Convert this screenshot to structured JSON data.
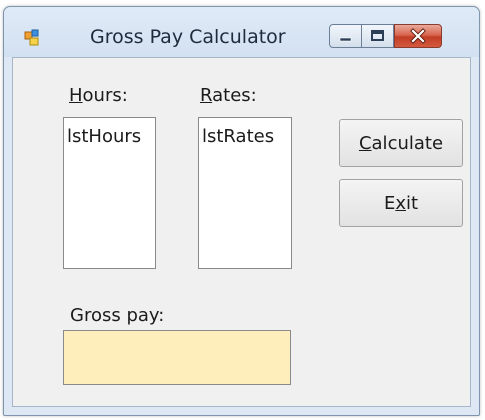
{
  "window": {
    "title": "Gross Pay Calculator",
    "colors": {
      "frame": "#dde8f4",
      "client": "#f0f0f0",
      "output_bg": "#fdeebc",
      "close_button": "#c23d26"
    },
    "caption_buttons": [
      {
        "name": "minimize",
        "icon": "minimize-icon"
      },
      {
        "name": "maximize",
        "icon": "maximize-icon"
      },
      {
        "name": "close",
        "icon": "close-icon"
      }
    ]
  },
  "form": {
    "hours_label": {
      "mnemonic": "H",
      "rest": "ours:"
    },
    "rates_label": {
      "mnemonic": "R",
      "rest": "ates:"
    },
    "hours_list": {
      "items": [
        "lstHours"
      ]
    },
    "rates_list": {
      "items": [
        "lstRates"
      ]
    },
    "calculate_button": {
      "mnemonic": "C",
      "rest": "alculate"
    },
    "exit_button": {
      "pre": "E",
      "mnemonic": "x",
      "post": "it"
    },
    "gross_pay_label": "Gross pay:",
    "gross_pay_value": ""
  }
}
